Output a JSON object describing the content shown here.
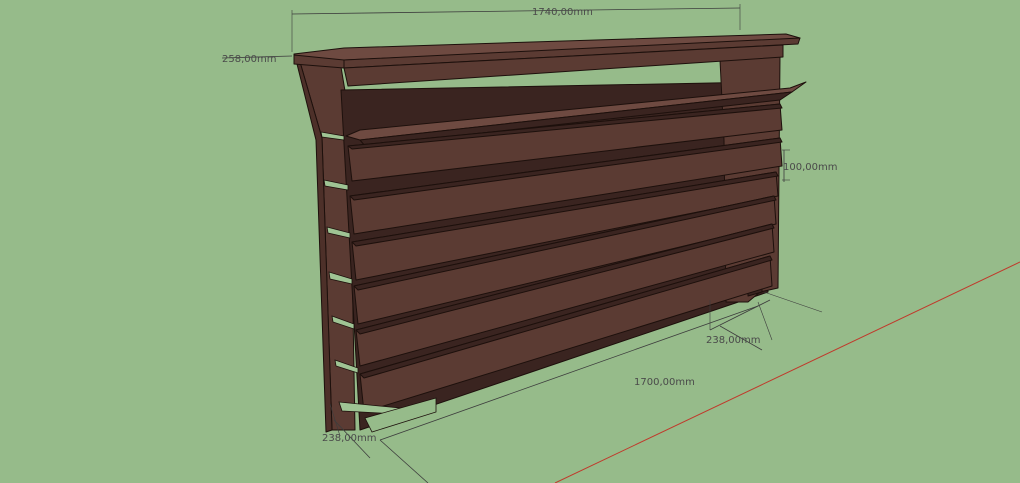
{
  "scene": {
    "background_color": "#96bb8a",
    "wood_color": "#5b3b33",
    "axis_color": "#c0392b"
  },
  "dimensions": {
    "top_length": "1740,00mm",
    "top_depth": "258,00mm",
    "slat_height": "100,00mm",
    "right_depth": "238,00mm",
    "base_length": "1700,00mm",
    "left_depth": "238,00mm"
  }
}
